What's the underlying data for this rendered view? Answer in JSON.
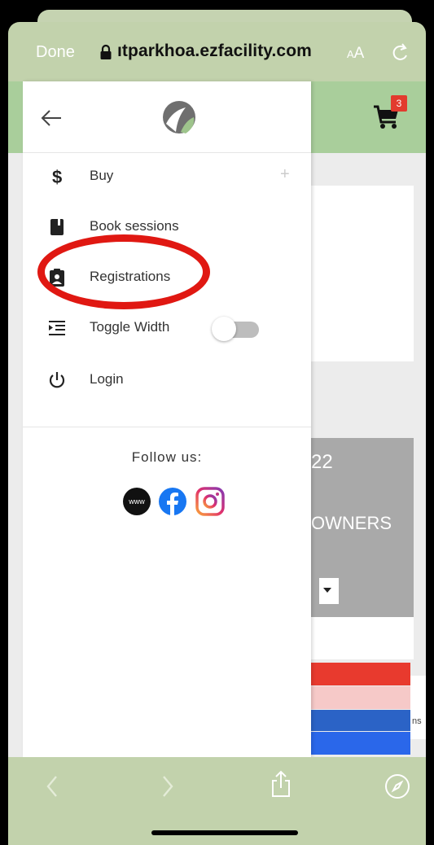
{
  "browser": {
    "done_label": "Done",
    "url": "ıtparkhoa.ezfacility.com",
    "aa_small": "A",
    "aa_large": "A",
    "lock_icon": "lock-icon",
    "reload_icon": "reload-icon"
  },
  "header": {
    "cart_count": "3",
    "cart_icon": "cart-icon"
  },
  "background": {
    "banner_year": "22",
    "banner_owners": "OWNERS",
    "side_widget_text": "ns"
  },
  "drawer": {
    "back_icon": "arrow-left-icon",
    "logo_icon": "logo-icon",
    "menu": [
      {
        "label": "Buy",
        "icon": "dollar-icon",
        "expand": "+"
      },
      {
        "label": "Book sessions",
        "icon": "book-icon"
      },
      {
        "label": "Registrations",
        "icon": "clipboard-user-icon"
      },
      {
        "label": "Toggle Width",
        "icon": "indent-icon",
        "toggle_on": false
      },
      {
        "label": "Login",
        "icon": "power-icon"
      }
    ],
    "follow_label": "Follow us:",
    "social": [
      {
        "name": "website",
        "icon": "www-icon",
        "text": "www"
      },
      {
        "name": "facebook",
        "icon": "facebook-icon"
      },
      {
        "name": "instagram",
        "icon": "instagram-icon"
      }
    ]
  },
  "annotation": {
    "color": "#e01812",
    "target": "Registrations"
  },
  "colors": {
    "browser_bar": "#c2d2ac",
    "site_header": "#a9ce9b",
    "badge": "#e23b2e",
    "banner": "#a9a9a9"
  },
  "toolbar": {
    "back_icon": "chevron-left-icon",
    "forward_icon": "chevron-right-icon",
    "share_icon": "share-icon",
    "compass_icon": "compass-icon"
  }
}
